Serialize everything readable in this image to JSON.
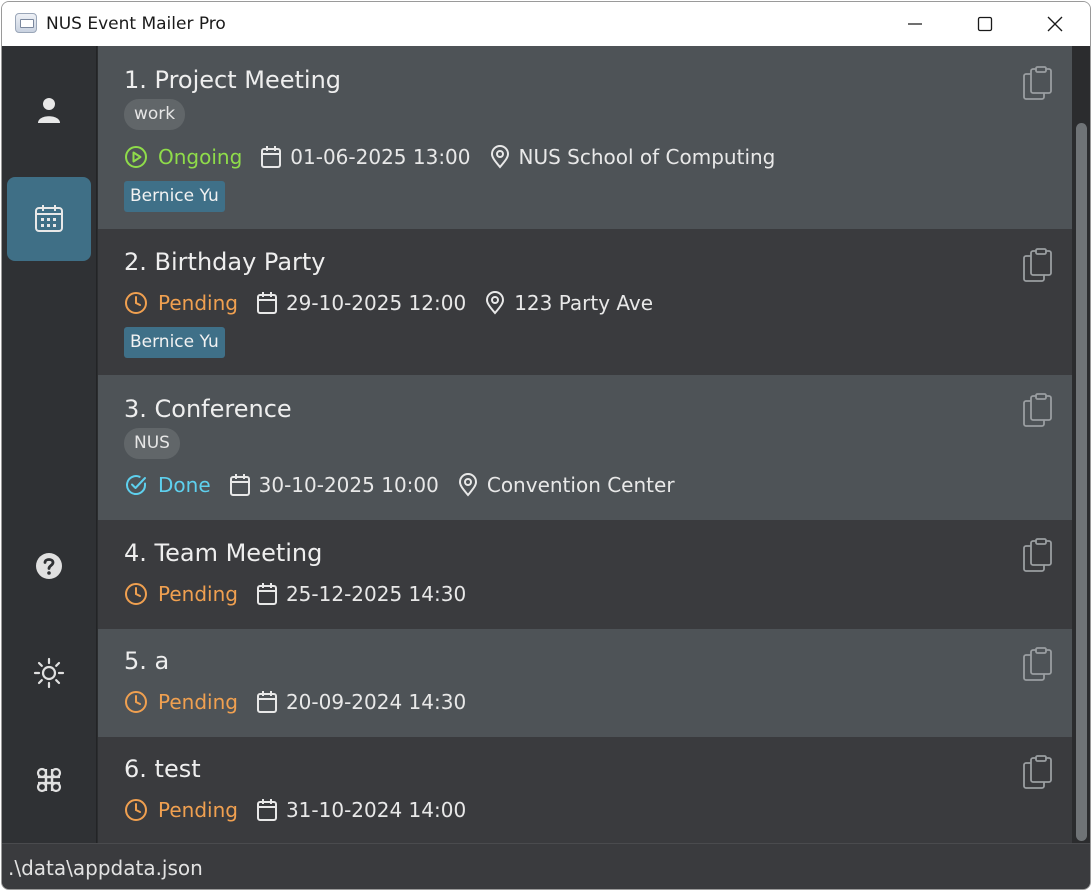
{
  "window": {
    "title": "NUS Event Mailer Pro"
  },
  "sidebar": {
    "items": [
      {
        "name": "contacts",
        "icon": "person-icon",
        "active": false
      },
      {
        "name": "events",
        "icon": "calendar-icon",
        "active": true
      },
      {
        "name": "help",
        "icon": "help-icon",
        "active": false
      },
      {
        "name": "theme",
        "icon": "sun-icon",
        "active": false
      },
      {
        "name": "commands",
        "icon": "command-icon",
        "active": false
      }
    ]
  },
  "events": [
    {
      "title": "1. Project Meeting",
      "tag": "work",
      "status": "Ongoing",
      "datetime": "01-06-2025 13:00",
      "location": "NUS School of Computing",
      "person": "Bernice Yu"
    },
    {
      "title": "2. Birthday Party",
      "tag": "",
      "status": "Pending",
      "datetime": "29-10-2025 12:00",
      "location": "123 Party Ave",
      "person": "Bernice Yu"
    },
    {
      "title": "3. Conference",
      "tag": "NUS",
      "status": "Done",
      "datetime": "30-10-2025 10:00",
      "location": "Convention Center",
      "person": ""
    },
    {
      "title": "4. Team Meeting",
      "tag": "",
      "status": "Pending",
      "datetime": "25-12-2025 14:30",
      "location": "",
      "person": ""
    },
    {
      "title": "5. a",
      "tag": "",
      "status": "Pending",
      "datetime": "20-09-2024 14:30",
      "location": "",
      "person": ""
    },
    {
      "title": "6. test",
      "tag": "",
      "status": "Pending",
      "datetime": "31-10-2024 14:00",
      "location": "",
      "person": ""
    }
  ],
  "statusbar": {
    "path": ".\\data\\appdata.json"
  },
  "colors": {
    "ongoing": "#8fdc4a",
    "pending": "#f0a050",
    "done": "#5ed0ee",
    "accent": "#3f6f86",
    "card_light": "#4e5357",
    "card_dark": "#3a3b3e"
  }
}
